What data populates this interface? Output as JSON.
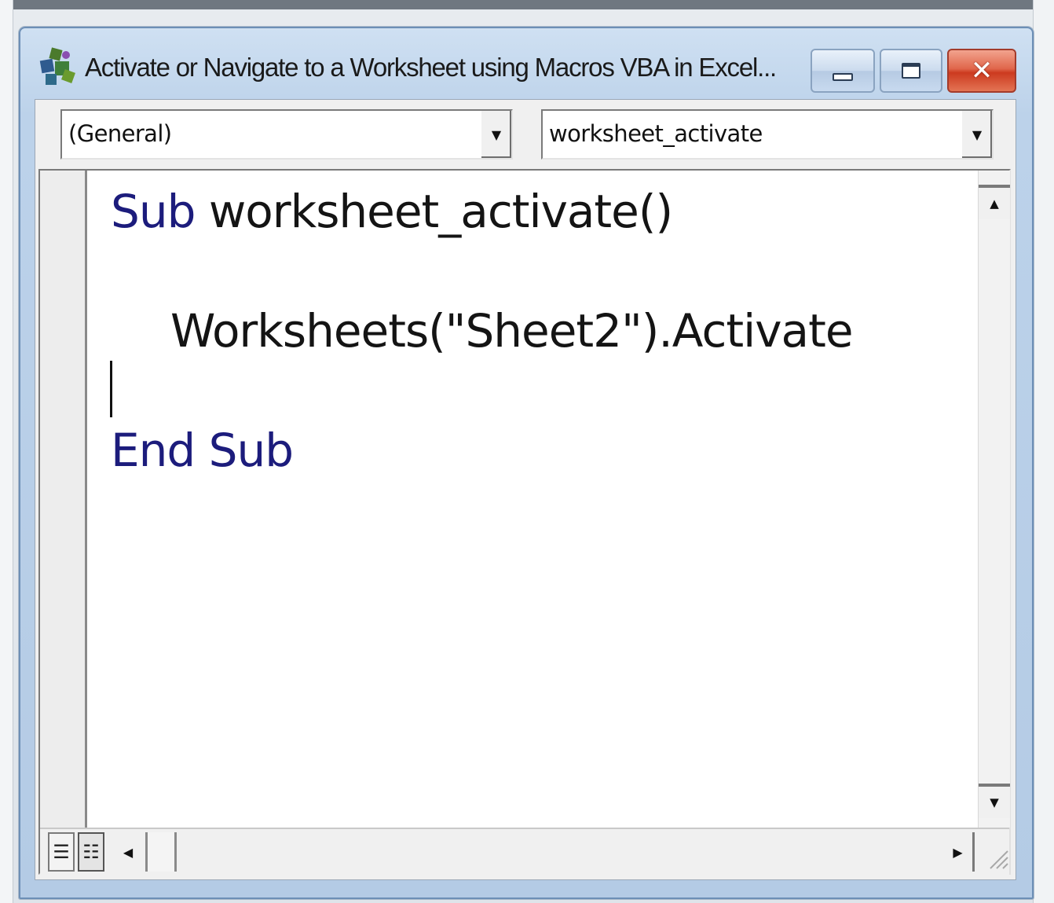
{
  "window": {
    "title": "Activate or Navigate to a Worksheet using Macros VBA in Excel...",
    "controls": {
      "minimize_icon": "minimize-icon",
      "maximize_icon": "maximize-icon",
      "close_glyph": "✕"
    }
  },
  "code_window": {
    "object_combo": {
      "value": "(General)"
    },
    "procedure_combo": {
      "value": "worksheet_activate"
    },
    "code": {
      "line1_keyword": "Sub",
      "line1_rest": " worksheet_activate()",
      "line2": "Worksheets(\"Sheet2\").Activate",
      "line3_keyword": "End Sub"
    },
    "view_buttons": [
      "procedure-view-icon",
      "full-module-view-icon"
    ]
  },
  "colors": {
    "keyword": "#1c1c7c",
    "title_bar": "#bcd2ea",
    "close_button": "#cc3a1f"
  }
}
